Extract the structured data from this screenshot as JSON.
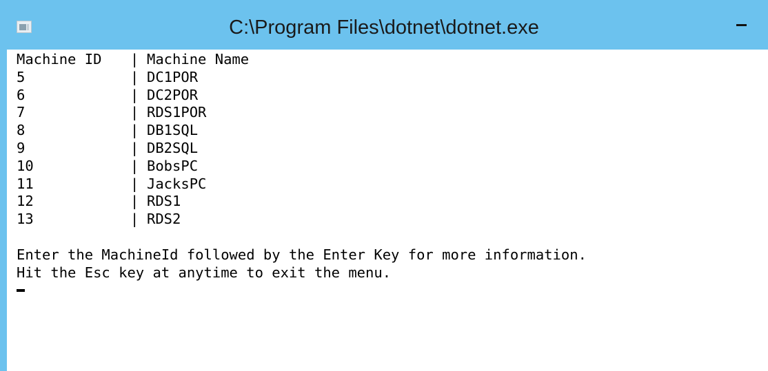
{
  "window": {
    "title": "C:\\Program Files\\dotnet\\dotnet.exe",
    "icon": "console-app-icon",
    "controls": {
      "minimize_icon": "minimize-icon"
    },
    "accent_color": "#6cc2ee"
  },
  "console": {
    "header": {
      "id": "Machine ID",
      "separator": "|",
      "name": "Machine Name"
    },
    "rows": [
      {
        "id": "5",
        "separator": "|",
        "name": "DC1POR"
      },
      {
        "id": "6",
        "separator": "|",
        "name": "DC2POR"
      },
      {
        "id": "7",
        "separator": "|",
        "name": "RDS1POR"
      },
      {
        "id": "8",
        "separator": "|",
        "name": "DB1SQL"
      },
      {
        "id": "9",
        "separator": "|",
        "name": "DB2SQL"
      },
      {
        "id": "10",
        "separator": "|",
        "name": "BobsPC"
      },
      {
        "id": "11",
        "separator": "|",
        "name": "JacksPC"
      },
      {
        "id": "12",
        "separator": "|",
        "name": "RDS1"
      },
      {
        "id": "13",
        "separator": "|",
        "name": "RDS2"
      }
    ],
    "prompt_line_1": "Enter the MachineId followed by the Enter Key for more information.",
    "prompt_line_2": "Hit the Esc key at anytime to exit the menu."
  }
}
